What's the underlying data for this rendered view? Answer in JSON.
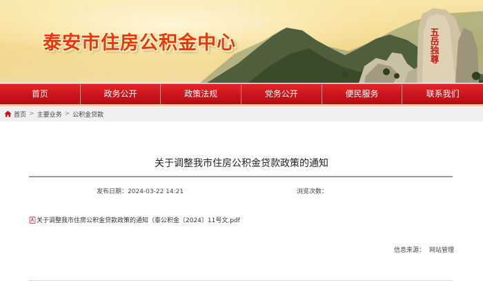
{
  "header": {
    "site_title": "泰安市住房公积金中心",
    "stone_inscription": "五岳独尊"
  },
  "nav": {
    "items": [
      "首页",
      "政务公开",
      "政策法规",
      "党务公开",
      "便民服务",
      "联系我们"
    ]
  },
  "breadcrumb": {
    "items": [
      "首页",
      "主要业务",
      "公积金贷款"
    ],
    "separator": ">"
  },
  "article": {
    "title": "关于调整我市住房公积金贷款政策的通知",
    "publish_date_label": "发布日期：",
    "publish_date": "2024-03-22 14:21",
    "views_label": "浏览次数：",
    "views": "",
    "attachment_name": "关于调整我市住房公积金贷款政策的通知（泰公积金〔2024〕11号文.pdf",
    "source_label": "信息来源：",
    "source_value": "网站管理"
  },
  "colors": {
    "nav_red": "#c8141b",
    "title_red": "#e8380d",
    "pdf_red": "#d32f2f"
  },
  "icons": [
    "home-icon",
    "pdf-icon"
  ]
}
